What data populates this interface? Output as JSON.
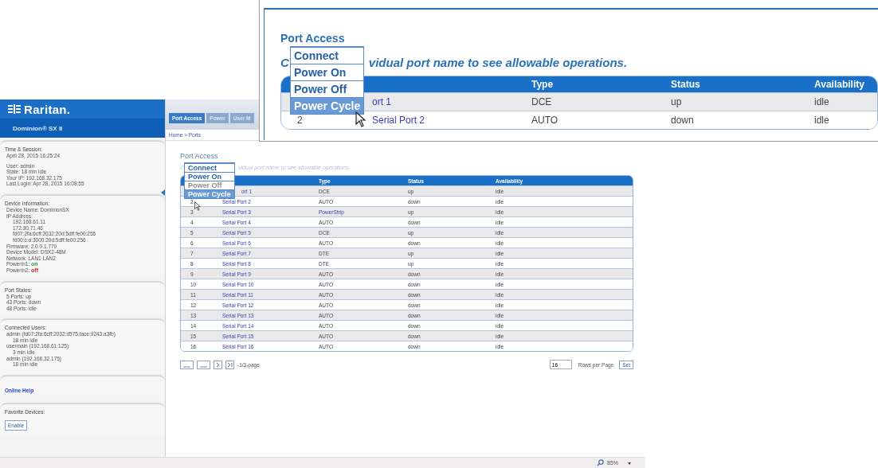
{
  "sidebar": {
    "logo": "Raritan.",
    "product": "Dominion® SX II",
    "sections": [
      {
        "kind": "info",
        "title": "Time & Session:",
        "lines": [
          {
            "text": "April 28, 2015 16:25:24"
          }
        ]
      },
      {
        "kind": "continued",
        "lines": [
          {
            "text": "User: admin"
          },
          {
            "text": "State: 18 min idle"
          },
          {
            "text": "Your IP: 192.168.32.175"
          },
          {
            "text": "Last Login: Apr 28, 2015 16:08:55"
          }
        ]
      },
      {
        "kind": "info",
        "title": "Device Information:",
        "lines": [
          {
            "text": "Device Name: DominionSX"
          },
          {
            "text": "IP Address:",
            "children": [
              {
                "text": "192.168.61.11"
              },
              {
                "text": "172.30.71.46"
              },
              {
                "text": "fd07:2fa:6cff:2032:20d:5dff:fe00:255"
              },
              {
                "text": "fd00:c:d:3000:20d:5dff:fe00:256"
              }
            ]
          },
          {
            "text": "Firmware: 2.0.0.1.770"
          },
          {
            "text": "Device Model: DSX2-48M"
          },
          {
            "text": "Network: LAN1 LAN2"
          },
          {
            "text": "PowerIn1: ",
            "value": "on",
            "on": true
          },
          {
            "text": "PowerIn2: ",
            "value": "off",
            "on": false
          }
        ]
      },
      {
        "kind": "info",
        "title": "Port States:",
        "lines": [
          {
            "text": "5 Ports: up"
          },
          {
            "text": "43 Ports: down"
          },
          {
            "text": "48 Ports: idle"
          }
        ]
      },
      {
        "kind": "info",
        "title": "Connected Users:",
        "lines": [
          {
            "text": "admin (fd07:2fa:6cff:2032:d575:face:9243:a3fb)",
            "children": [
              {
                "text": "18 min idle"
              }
            ]
          },
          {
            "text": "usermain (192.168.61.125)",
            "children": [
              {
                "text": "3 min idle"
              }
            ]
          },
          {
            "text": "admin (192.168.32.175)",
            "children": [
              {
                "text": "18 min idle"
              }
            ]
          }
        ]
      },
      {
        "kind": "link",
        "title": "Online Help"
      },
      {
        "kind": "button",
        "title": "Favorite Devices:",
        "button": "Enable"
      }
    ]
  },
  "nav_tabs": [
    {
      "label": "Port Access",
      "selected": true
    },
    {
      "label": "Power",
      "selected": false
    },
    {
      "label": "User M",
      "selected": false
    }
  ],
  "breadcrumb": "Home > Ports",
  "port_access": {
    "title": "Port Access",
    "instruction_start": "C",
    "instruction_end": "vidual port name to see allowable operations.",
    "menu": [
      {
        "label": "Connect",
        "selected": false,
        "disabled": false
      },
      {
        "label": "Power On",
        "selected": false,
        "disabled": false
      },
      {
        "label": "Power Off",
        "selected": false,
        "disabled": true
      },
      {
        "label": "Power Cycle",
        "selected": true,
        "disabled": false
      }
    ],
    "columns": [
      "Type",
      "Status",
      "Availability"
    ],
    "rows": [
      {
        "name": "ort 1",
        "type": "DCE",
        "status": "up",
        "availability": "idle"
      },
      {
        "number": "2",
        "name": "Serial Port 2",
        "type": "AUTO",
        "status": "down",
        "availability": "idle"
      },
      {
        "number": "3",
        "name": "Serial Port 3",
        "type": "PowerStrip",
        "type_link": true,
        "status": "up",
        "availability": "idle"
      },
      {
        "number": "4",
        "name": "Serial Port 4",
        "type": "AUTO",
        "status": "down",
        "availability": "idle"
      },
      {
        "number": "5",
        "name": "Serial Port 5",
        "type": "DCE",
        "status": "up",
        "availability": "idle"
      },
      {
        "number": "6",
        "name": "Serial Port 6",
        "type": "AUTO",
        "status": "down",
        "availability": "idle"
      },
      {
        "number": "7",
        "name": "Serial Port 7",
        "type": "DTE",
        "status": "up",
        "availability": "idle"
      },
      {
        "number": "8",
        "name": "Serial Port 8",
        "type": "DTE",
        "status": "up",
        "availability": "idle"
      },
      {
        "number": "9",
        "name": "Serial Port 9",
        "type": "AUTO",
        "status": "down",
        "availability": "idle"
      },
      {
        "number": "10",
        "name": "Serial Port 10",
        "type": "AUTO",
        "status": "down",
        "availability": "idle"
      },
      {
        "number": "11",
        "name": "Serial Port 11",
        "type": "AUTO",
        "status": "down",
        "availability": "idle"
      },
      {
        "number": "12",
        "name": "Serial Port 12",
        "type": "AUTO",
        "status": "down",
        "availability": "idle"
      },
      {
        "number": "13",
        "name": "Serial Port 13",
        "type": "AUTO",
        "status": "down",
        "availability": "idle"
      },
      {
        "number": "14",
        "name": "Serial Port 14",
        "type": "AUTO",
        "status": "down",
        "availability": "idle"
      },
      {
        "number": "15",
        "name": "Serial Port 15",
        "type": "AUTO",
        "status": "down",
        "availability": "idle"
      },
      {
        "number": "16",
        "name": "Serial Port 16",
        "type": "AUTO",
        "status": "down",
        "availability": "idle"
      }
    ],
    "pagination": {
      "buttons": [
        {
          "kind": "first"
        },
        {
          "kind": "prev"
        },
        {
          "kind": "next"
        },
        {
          "kind": "last"
        }
      ],
      "label": "-1/3-page"
    },
    "rows_per_page": {
      "value": "16",
      "label": "Rows per Page",
      "button": "Set"
    }
  },
  "status_bar": {
    "zoom": "85%"
  },
  "callout": {
    "title": "Port Access",
    "instruction_start": "C",
    "instruction_end": "vidual port name to see allowable operations.",
    "menu": [
      {
        "label": "Connect",
        "selected": false,
        "disabled": false
      },
      {
        "label": "Power On",
        "selected": false,
        "disabled": false
      },
      {
        "label": "Power Off",
        "selected": false,
        "disabled": false
      },
      {
        "label": "Power Cycle",
        "selected": true,
        "disabled": false
      }
    ],
    "columns": [
      "Type",
      "Status",
      "Availability"
    ],
    "rows": [
      {
        "name": "ort 1",
        "type": "DCE",
        "status": "up",
        "availability": "idle"
      },
      {
        "number": "2",
        "name": "Serial Port 2",
        "type": "AUTO",
        "status": "down",
        "availability": "idle"
      }
    ]
  }
}
